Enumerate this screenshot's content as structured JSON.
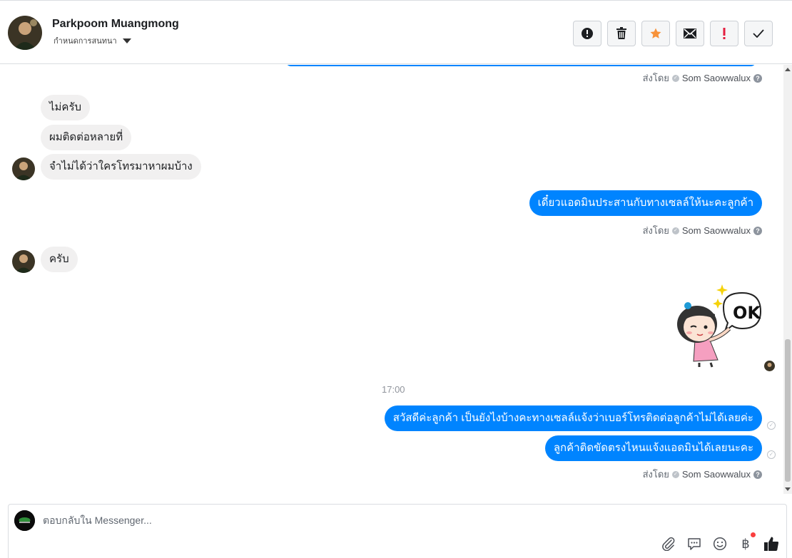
{
  "header": {
    "name": "Parkpoom Muangmong",
    "subtitle": "กำหนดการสนทนา",
    "actions": [
      {
        "icon": "alert-circle-icon",
        "color": "#1c1e21"
      },
      {
        "icon": "trash-icon",
        "color": "#1c1e21"
      },
      {
        "icon": "star-icon",
        "color": "#f7923a"
      },
      {
        "icon": "envelope-icon",
        "color": "#1c1e21"
      },
      {
        "icon": "exclamation-icon",
        "color": "#e41e3f"
      },
      {
        "icon": "checkmark-icon",
        "color": "#1c1e21"
      }
    ]
  },
  "thread": {
    "sent_by_label": "ส่งโดย",
    "agent": "Som Saowwalux",
    "incoming_1": [
      "ไม่ครับ",
      "ผมติดต่อหลายที่",
      "จำไม่ได้ว่าใครโทรมาหาผมบ้าง"
    ],
    "outgoing_1": "เดี๋ยวแอดมินประสานกับทางเซลล์ให้นะคะลูกค้า",
    "incoming_2": "ครับ",
    "sticker_text": "OK",
    "timestamp": "17:00",
    "outgoing_2": [
      "สวัสดีค่ะลูกค้า เป็นยังไงบ้างคะทางเซลล์แจ้งว่าเบอร์โทรติดต่อลูกค้าไม่ได้เลยค่ะ",
      "ลูกค้าติดขัดตรงไหนแจ้งแอดมินได้เลยนะคะ"
    ]
  },
  "composer": {
    "placeholder": "ตอบกลับใน Messenger...",
    "tools": [
      "paperclip-icon",
      "chat-bubble-icon",
      "smiley-icon",
      "baht-icon",
      "thumbs-up-icon"
    ],
    "baht_symbol": "฿"
  },
  "colors": {
    "accent": "#0084ff",
    "incoming_bubble": "#f1f0f0"
  }
}
